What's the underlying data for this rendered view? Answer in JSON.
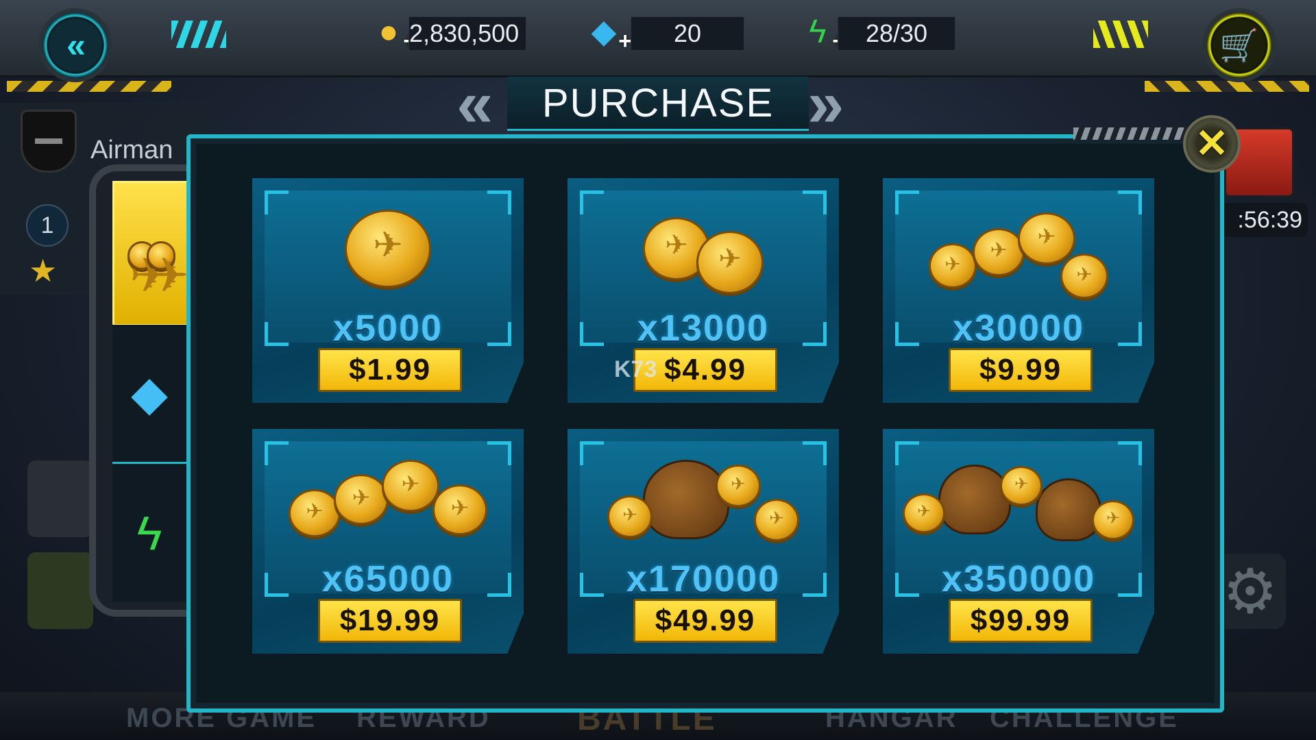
{
  "topbar": {
    "gold": "2,830,500",
    "gems": "20",
    "energy": "28/30"
  },
  "title": "PURCHASE",
  "profile": {
    "rank_name": "Airman",
    "level": "1"
  },
  "timer": ":56:39",
  "tabs": [
    {
      "name": "coins",
      "icon": "coins-icon",
      "active": true
    },
    {
      "name": "gems",
      "icon": "diamond-icon",
      "active": false
    },
    {
      "name": "energy",
      "icon": "lightning-icon",
      "active": false
    }
  ],
  "products": [
    {
      "quantity": "x5000",
      "price": "$1.99"
    },
    {
      "quantity": "x13000",
      "price": "$4.99"
    },
    {
      "quantity": "x30000",
      "price": "$9.99"
    },
    {
      "quantity": "x65000",
      "price": "$19.99"
    },
    {
      "quantity": "x170000",
      "price": "$49.99"
    },
    {
      "quantity": "x350000",
      "price": "$99.99"
    }
  ],
  "nav": {
    "more_game": "MORE GAME",
    "reward": "REWARD",
    "battle": "BATTLE",
    "hangar": "HANGAR",
    "challenge": "CHALLENGE"
  },
  "watermark": "K73",
  "colors": {
    "accent_cyan": "#22b6c8",
    "price_gold": "#f2b708",
    "quantity_blue": "#4fc3f5"
  }
}
